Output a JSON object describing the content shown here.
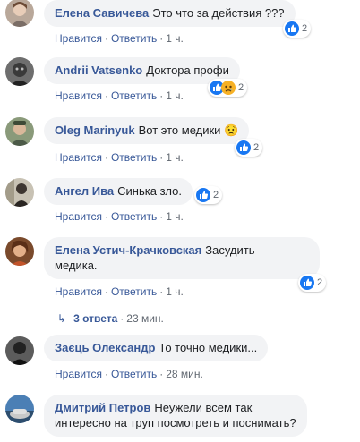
{
  "comments": [
    {
      "author": "Елена Савичева",
      "text": "Это что за действия ???",
      "like": "Нравится",
      "reply": "Ответить",
      "time": "1 ч.",
      "reactions": [
        "like-icon"
      ],
      "reaction_count": "2"
    },
    {
      "author": "Andrii Vatsenko",
      "text": "Доктора профи",
      "like": "Нравится",
      "reply": "Ответить",
      "time": "1 ч.",
      "reactions": [
        "like-icon",
        "sad-icon"
      ],
      "reaction_count": "2"
    },
    {
      "author": "Oleg Marinyuk",
      "text": "Вот это медики 😟",
      "like": "Нравится",
      "reply": "Ответить",
      "time": "1 ч.",
      "reactions": [
        "like-icon"
      ],
      "reaction_count": "2"
    },
    {
      "author": "Ангел Ива",
      "text": "Синька зло.",
      "like": "Нравится",
      "reply": "Ответить",
      "time": "1 ч.",
      "reactions": [
        "like-icon"
      ],
      "reaction_count": "2"
    },
    {
      "author": "Елена Устич-Крачковская",
      "text_line1": "Засудить",
      "text_line2": "медика.",
      "like": "Нравится",
      "reply": "Ответить",
      "time": "1 ч.",
      "reactions": [
        "like-icon"
      ],
      "reaction_count": "2",
      "replies_label": "3 ответа",
      "replies_time": "23 мин."
    },
    {
      "author": "Заєць Олександр",
      "text": "То точно медики...",
      "like": "Нравится",
      "reply": "Ответить",
      "time": "28 мин."
    },
    {
      "author": "Дмитрий Петров",
      "text_line1": "Неужели всем так",
      "text_line2": "интересно на труп посмотреть и поснимать?"
    }
  ],
  "separator": "·",
  "colors": {
    "link": "#385898",
    "bubble": "#f2f3f5",
    "meta": "#606770",
    "like_blue": "#1877f2"
  }
}
